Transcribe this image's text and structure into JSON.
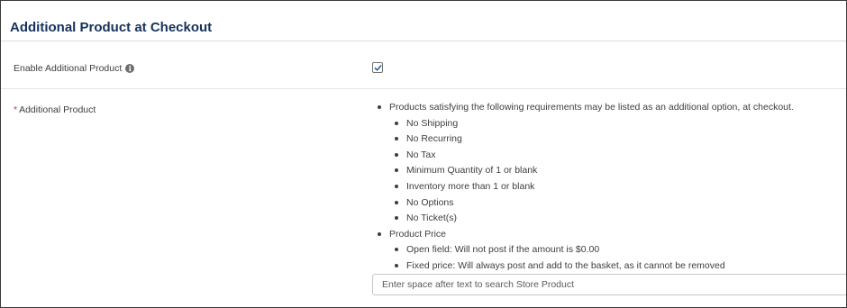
{
  "section": {
    "title": "Additional Product at Checkout"
  },
  "enable_field": {
    "label": "Enable Additional Product",
    "info_icon": "info-icon",
    "checked": true
  },
  "product_field": {
    "required_marker": "*",
    "label": "Additional Product",
    "requirements": {
      "intro": "Products satisfying the following requirements may be listed as an additional option, at checkout.",
      "items": [
        "No Shipping",
        "No Recurring",
        "No Tax",
        "Minimum Quantity of 1 or blank",
        "Inventory more than 1 or blank",
        "No Options",
        "No Ticket(s)"
      ]
    },
    "price": {
      "heading": "Product Price",
      "items": [
        "Open field: Will not post if the amount is $0.00",
        "Fixed price: Will always post and add to the basket, as it cannot be removed"
      ]
    },
    "search": {
      "placeholder": "Enter space after text to search Store Product",
      "value": ""
    }
  },
  "colors": {
    "title": "#16325c",
    "required": "#c23934",
    "checkbox_check": "#1b5297"
  }
}
